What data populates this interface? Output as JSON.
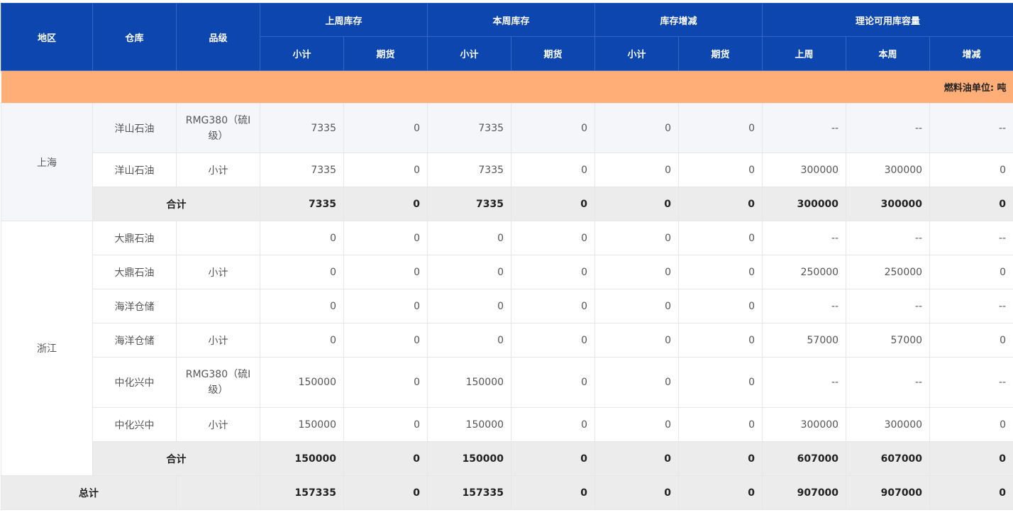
{
  "header": {
    "region": "地区",
    "warehouse": "仓库",
    "grade": "品级",
    "groups": [
      "上周库存",
      "本周库存",
      "库存增减",
      "理论可用库容量"
    ],
    "sub": [
      "小计",
      "期货",
      "小计",
      "期货",
      "小计",
      "期货",
      "上周",
      "本周",
      "增减"
    ]
  },
  "section": {
    "name": "燃料油",
    "unit": "单位: 吨"
  },
  "regions": [
    {
      "name": "上海",
      "rows": [
        {
          "warehouse": "洋山石油",
          "grade": "RMG380（硫Ⅰ级）",
          "values": [
            "7335",
            "0",
            "7335",
            "0",
            "0",
            "0",
            "--",
            "--",
            "--"
          ]
        },
        {
          "warehouse": "洋山石油",
          "grade": "小计",
          "values": [
            "7335",
            "0",
            "7335",
            "0",
            "0",
            "0",
            "300000",
            "300000",
            "0"
          ]
        }
      ],
      "subtotal": {
        "label": "合计",
        "values": [
          "7335",
          "0",
          "7335",
          "0",
          "0",
          "0",
          "300000",
          "300000",
          "0"
        ]
      }
    },
    {
      "name": "浙江",
      "rows": [
        {
          "warehouse": "大鼎石油",
          "grade": "",
          "values": [
            "0",
            "0",
            "0",
            "0",
            "0",
            "0",
            "--",
            "--",
            "--"
          ]
        },
        {
          "warehouse": "大鼎石油",
          "grade": "小计",
          "values": [
            "0",
            "0",
            "0",
            "0",
            "0",
            "0",
            "250000",
            "250000",
            "0"
          ]
        },
        {
          "warehouse": "海洋仓储",
          "grade": "",
          "values": [
            "0",
            "0",
            "0",
            "0",
            "0",
            "0",
            "--",
            "--",
            "--"
          ]
        },
        {
          "warehouse": "海洋仓储",
          "grade": "小计",
          "values": [
            "0",
            "0",
            "0",
            "0",
            "0",
            "0",
            "57000",
            "57000",
            "0"
          ]
        },
        {
          "warehouse": "中化兴中",
          "grade": "RMG380（硫Ⅰ级）",
          "values": [
            "150000",
            "0",
            "150000",
            "0",
            "0",
            "0",
            "--",
            "--",
            "--"
          ]
        },
        {
          "warehouse": "中化兴中",
          "grade": "小计",
          "values": [
            "150000",
            "0",
            "150000",
            "0",
            "0",
            "0",
            "300000",
            "300000",
            "0"
          ]
        }
      ],
      "subtotal": {
        "label": "合计",
        "values": [
          "150000",
          "0",
          "150000",
          "0",
          "0",
          "0",
          "607000",
          "607000",
          "0"
        ]
      }
    }
  ],
  "total": {
    "label": "总计",
    "values": [
      "157335",
      "0",
      "157335",
      "0",
      "0",
      "0",
      "907000",
      "907000",
      "0"
    ]
  }
}
